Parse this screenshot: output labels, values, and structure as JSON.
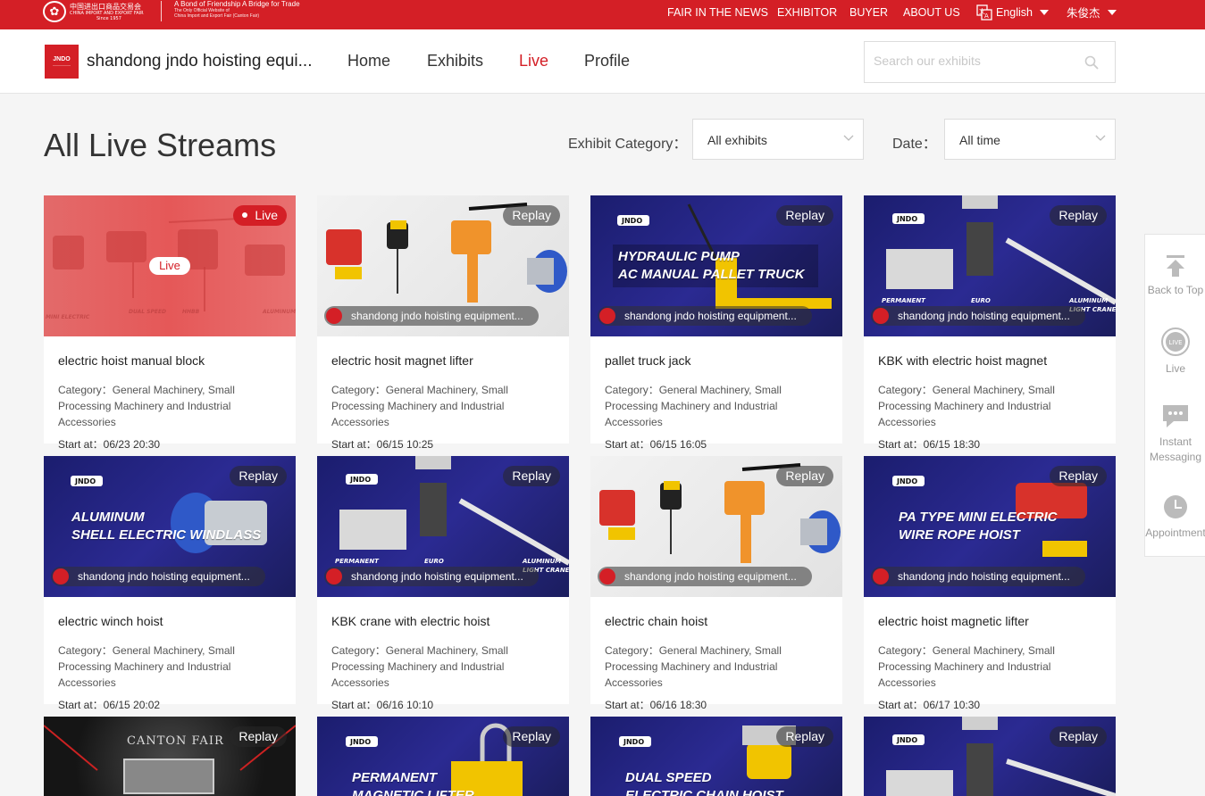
{
  "topbar": {
    "logo_cn": "中国进出口商品交易会",
    "logo_en": "CHINA IMPORT AND EXPORT FAIR",
    "logo_since": "Since 1957",
    "slogan": "A Bond of Friendship A Bridge for Trade",
    "slogan_sub1": "The Only Official Website of",
    "slogan_sub2": "China Import and Export Fair (Canton Fair)",
    "nav": [
      "FAIR IN THE NEWS",
      "EXHIBITOR",
      "BUYER",
      "ABOUT US"
    ],
    "language": "English",
    "user": "朱俊杰",
    "accent": "#d41f26"
  },
  "header": {
    "brand_logo": "JNDO",
    "brand_name": "shandong jndo hoisting equi...",
    "nav": [
      "Home",
      "Exhibits",
      "Live",
      "Profile"
    ],
    "active_nav": "Live",
    "search_placeholder": "Search our exhibits"
  },
  "main": {
    "title": "All Live Streams",
    "category_label": "Exhibit Category：",
    "category_value": "All exhibits",
    "date_label": "Date：",
    "date_value": "All time"
  },
  "cards": [
    {
      "badge": "Live",
      "title": "electric hoist manual block",
      "category": "Category：General Machinery, Small Processing Machinery and Industrial Accessories",
      "start": "Start at：06/23 20:30",
      "exhibitor": "",
      "center_pill": "Live",
      "banner": ""
    },
    {
      "badge": "Replay",
      "title": "electric hosit magnet lifter",
      "category": "Category：General Machinery, Small Processing Machinery and Industrial Accessories",
      "start": "Start at：06/15 10:25",
      "exhibitor": "shandong jndo hoisting equipment...",
      "banner": ""
    },
    {
      "badge": "Replay",
      "title": "pallet truck jack",
      "category": "Category：General Machinery, Small Processing Machinery and Industrial Accessories",
      "start": "Start at：06/15 16:05",
      "exhibitor": "shandong jndo hoisting equipment...",
      "banner": "HYDRAULIC PUMP\nAC MANUAL PALLET TRUCK"
    },
    {
      "badge": "Replay",
      "title": "KBK with electric hoist magnet",
      "category": "Category：General Machinery, Small Processing Machinery and Industrial Accessories",
      "start": "Start at：06/15 18:30",
      "exhibitor": "shandong jndo hoisting equipment...",
      "banner": ""
    },
    {
      "badge": "Replay",
      "title": "electric winch hoist",
      "category": "Category：General Machinery, Small Processing Machinery and Industrial Accessories",
      "start": "Start at：06/15 20:02",
      "exhibitor": "shandong jndo hoisting equipment...",
      "banner": "ALUMINUM\nSHELL ELECTRIC WINDLASS"
    },
    {
      "badge": "Replay",
      "title": "KBK crane with electric hoist",
      "category": "Category：General Machinery, Small Processing Machinery and Industrial Accessories",
      "start": "Start at：06/16 10:10",
      "exhibitor": "shandong jndo hoisting equipment...",
      "banner": ""
    },
    {
      "badge": "Replay",
      "title": "electric chain hoist",
      "category": "Category：General Machinery, Small Processing Machinery and Industrial Accessories",
      "start": "Start at：06/16 18:30",
      "exhibitor": "shandong jndo hoisting equipment...",
      "banner": ""
    },
    {
      "badge": "Replay",
      "title": "electric hoist magnetic lifter",
      "category": "Category：General Machinery, Small Processing Machinery and Industrial Accessories",
      "start": "Start at：06/17 10:30",
      "exhibitor": "shandong jndo hoisting equipment...",
      "banner": "PA TYPE MINI ELECTRIC\nWIRE ROPE HOIST"
    },
    {
      "badge": "Replay",
      "title": "",
      "category": "",
      "start": "",
      "exhibitor": "",
      "banner": "CANTON FAIR"
    },
    {
      "badge": "Replay",
      "title": "",
      "category": "",
      "start": "",
      "exhibitor": "",
      "banner": "PERMANENT\nMAGNETIC LIFTER"
    },
    {
      "badge": "Replay",
      "title": "",
      "category": "",
      "start": "",
      "exhibitor": "",
      "banner": "DUAL SPEED\nELECTRIC CHAIN HOIST"
    },
    {
      "badge": "Replay",
      "title": "",
      "category": "",
      "start": "",
      "exhibitor": "",
      "banner": ""
    }
  ],
  "rail": {
    "back_to_top": "Back to Top",
    "live": "Live",
    "instant_messaging": "Instant Messaging",
    "appointment": "Appointment"
  }
}
